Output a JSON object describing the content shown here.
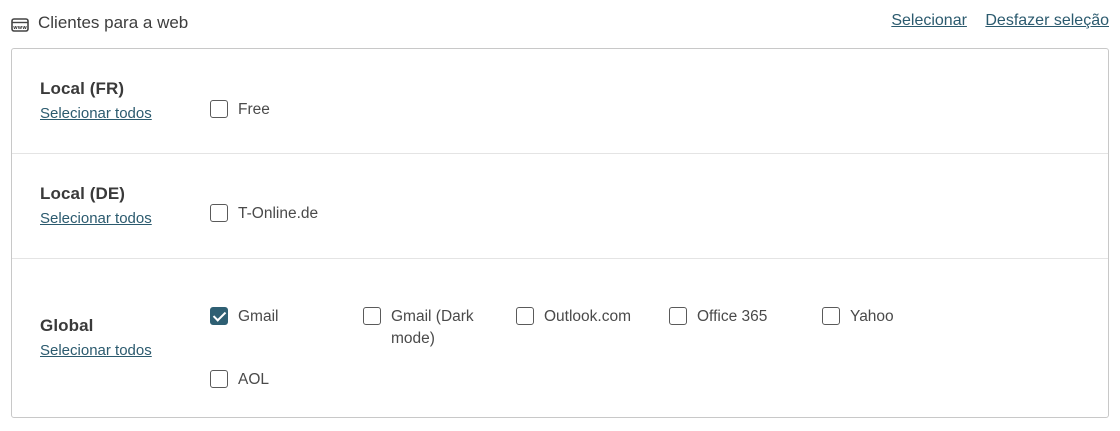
{
  "header": {
    "title": "Clientes para a web",
    "icon": "www-icon",
    "select_label": "Selecionar",
    "deselect_label": "Desfazer seleção"
  },
  "sections": [
    {
      "name": "Local (FR)",
      "select_all": "Selecionar todos",
      "options": [
        {
          "label": "Free",
          "checked": false
        }
      ]
    },
    {
      "name": "Local (DE)",
      "select_all": "Selecionar todos",
      "options": [
        {
          "label": "T-Online.de",
          "checked": false
        }
      ]
    },
    {
      "name": "Global",
      "select_all": "Selecionar todos",
      "options": [
        {
          "label": "Gmail",
          "checked": true
        },
        {
          "label": "Gmail (Dark mode)",
          "checked": false
        },
        {
          "label": "Outlook.com",
          "checked": false
        },
        {
          "label": "Office 365",
          "checked": false
        },
        {
          "label": "Yahoo",
          "checked": false
        },
        {
          "label": "AOL",
          "checked": false
        }
      ]
    }
  ],
  "colors": {
    "accent": "#2e5f73",
    "link": "#2b5a6e",
    "border": "#c8c8c8"
  }
}
